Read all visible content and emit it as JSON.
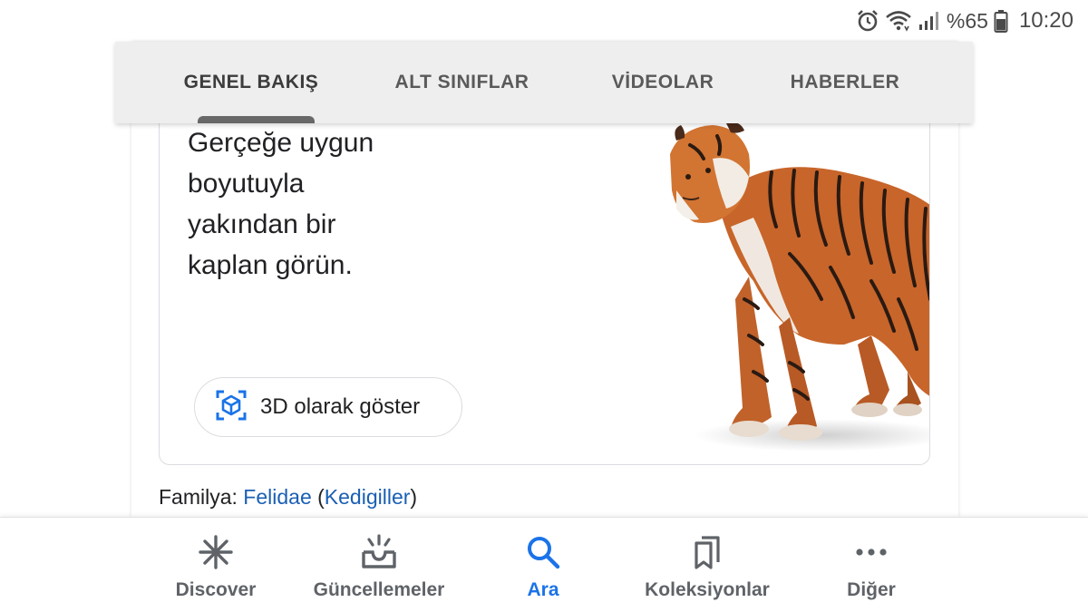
{
  "status_bar": {
    "battery_text": "%65",
    "time": "10:20",
    "icons": [
      "alarm-icon",
      "wifi-icon",
      "signal-icon",
      "battery-icon"
    ]
  },
  "tabs": [
    {
      "label": "GENEL BAKIŞ",
      "active": true
    },
    {
      "label": "ALT SINIFLAR",
      "active": false
    },
    {
      "label": "VİDEOLAR",
      "active": false
    },
    {
      "label": "HABERLER",
      "active": false
    }
  ],
  "ar_card": {
    "line1": "Gerçeğe uygun",
    "line2": "boyutuyla",
    "line3": "yakından bir",
    "line4": "kaplan görün.",
    "button_label": "3D olarak göster",
    "button_icon": "view-in-3d-icon",
    "image": "tiger-3d-model"
  },
  "family": {
    "label": "Familya:",
    "link1": "Felidae",
    "open_paren": "(",
    "link2": "Kedigiller",
    "close_paren": ")"
  },
  "bottom_nav": [
    {
      "label": "Discover",
      "icon": "asterisk-icon",
      "active": false
    },
    {
      "label": "Güncellemeler",
      "icon": "updates-tray-icon",
      "active": false
    },
    {
      "label": "Ara",
      "icon": "search-icon",
      "active": true
    },
    {
      "label": "Koleksiyonlar",
      "icon": "bookmarks-icon",
      "active": false
    },
    {
      "label": "Diğer",
      "icon": "more-horiz-icon",
      "active": false
    }
  ],
  "colors": {
    "accent": "#1a73e8",
    "link": "#1a5fb4",
    "tab_bar_bg": "#eeeeee",
    "tiger_orange": "#c8652a"
  }
}
